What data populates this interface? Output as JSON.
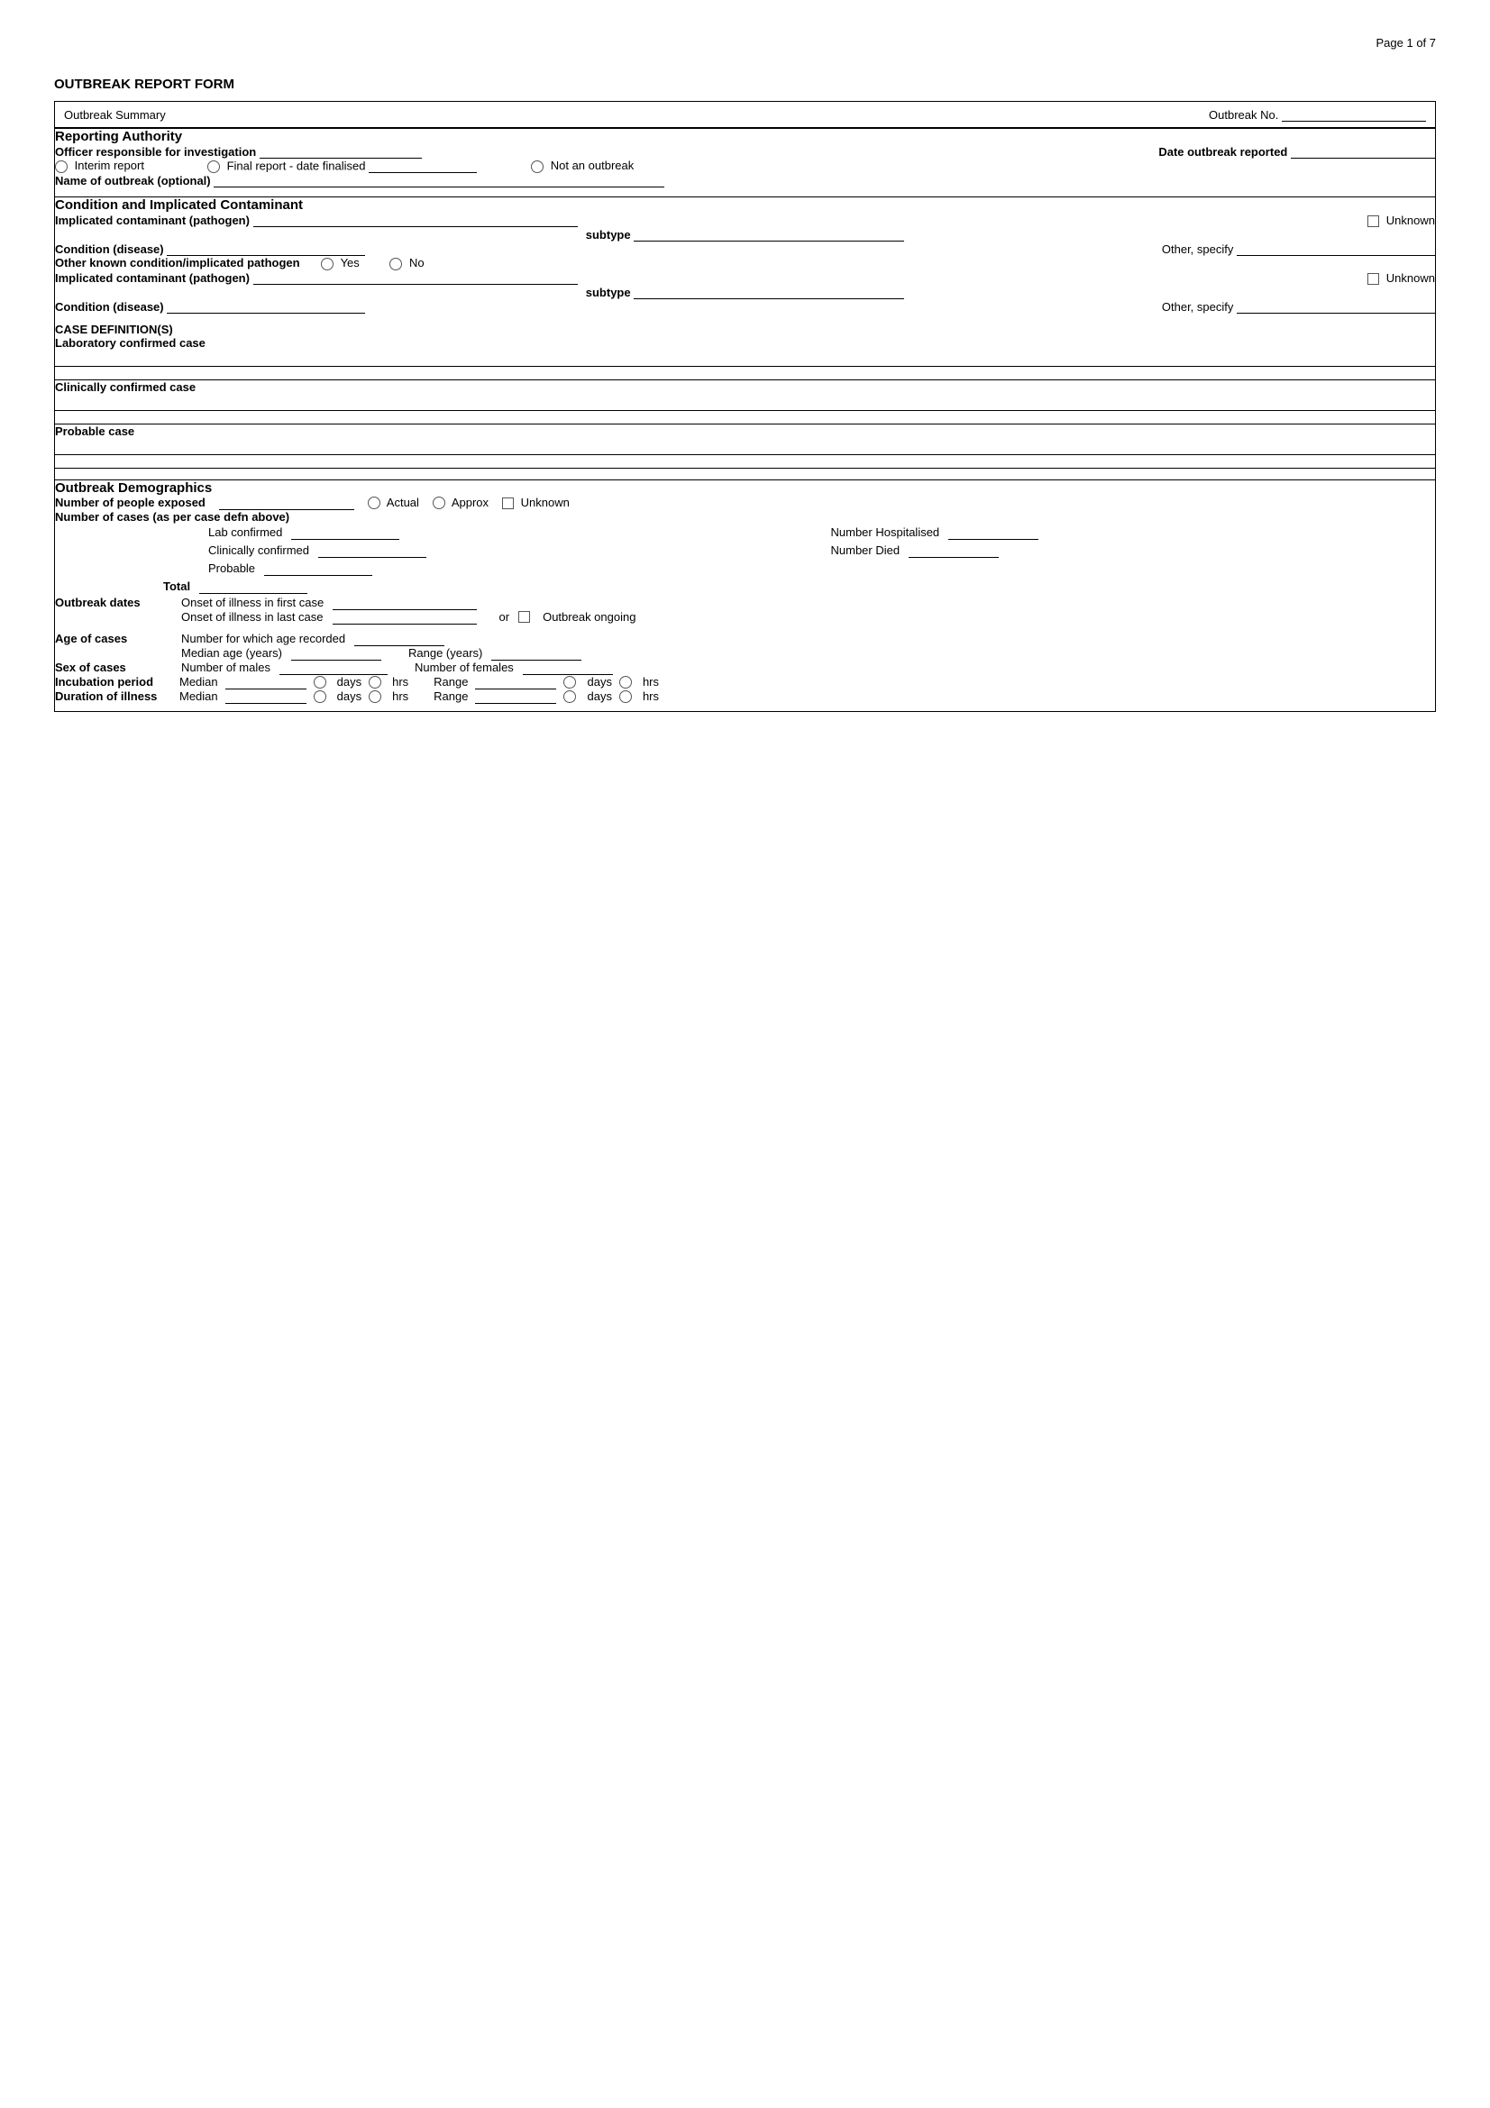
{
  "page": {
    "page_number": "Page 1 of 7",
    "title": "OUTBREAK REPORT FORM"
  },
  "header": {
    "outbreak_summary": "Outbreak Summary",
    "outbreak_no": "Outbreak No."
  },
  "sections": {
    "reporting_authority": {
      "label": "Reporting Authority",
      "officer_label": "Officer responsible for investigation",
      "date_label": "Date outbreak reported",
      "interim_label": "Interim report",
      "final_label": "Final report  - date finalised",
      "not_outbreak_label": "Not an outbreak",
      "name_label": "Name of outbreak (optional)"
    },
    "condition": {
      "label": "Condition and Implicated Contaminant",
      "implicated_label": "Implicated contaminant (pathogen)",
      "unknown_label": "Unknown",
      "subtype_label": "subtype",
      "condition_label": "Condition (disease)",
      "other_specify": "Other, specify",
      "other_known_label": "Other known condition/implicated pathogen",
      "yes_label": "Yes",
      "no_label": "No",
      "implicated_label2": "Implicated contaminant (pathogen)",
      "unknown_label2": "Unknown",
      "subtype_label2": "subtype",
      "condition_label2": "Condition (disease)",
      "other_specify2": "Other, specify",
      "case_def_label": "CASE DEFINITION(S)",
      "lab_confirmed_label": "Laboratory confirmed case",
      "clinically_label": "Clinically confirmed case",
      "probable_label": "Probable case"
    },
    "demographics": {
      "label": "Outbreak Demographics",
      "exposed_label": "Number of people exposed",
      "actual_label": "Actual",
      "approx_label": "Approx",
      "unknown_label": "Unknown",
      "cases_label": "Number of cases (as per case defn above)",
      "lab_confirmed": "Lab confirmed",
      "clinically_confirmed": "Clinically confirmed",
      "probable": "Probable",
      "total": "Total",
      "number_hospitalised": "Number Hospitalised",
      "number_died": "Number Died",
      "outbreak_dates_label": "Outbreak dates",
      "onset_first": "Onset of illness in first case",
      "onset_last": "Onset of illness in last case",
      "or_label": "or",
      "outbreak_ongoing": "Outbreak ongoing",
      "age_label": "Age of cases",
      "age_recorded": "Number for which age recorded",
      "median_age": "Median age (years)",
      "range_years": "Range (years)",
      "sex_label": "Sex of cases",
      "num_males": "Number of males",
      "num_females": "Number of females",
      "incubation_label": "Incubation period",
      "median": "Median",
      "days": "days",
      "hrs": "hrs",
      "range": "Range",
      "duration_label": "Duration of illness",
      "median2": "Median"
    }
  }
}
